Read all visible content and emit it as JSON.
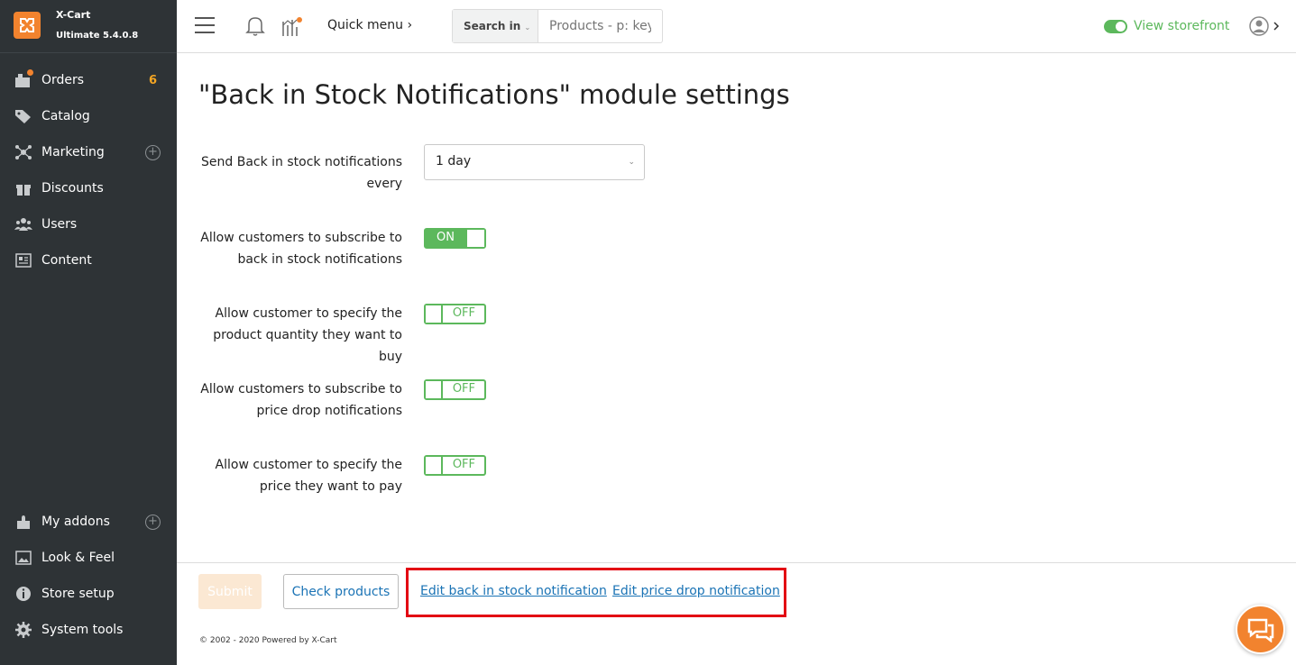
{
  "brand": {
    "name": "X-Cart",
    "version": "Ultimate 5.4.0.8"
  },
  "sidebar": {
    "items": [
      {
        "label": "Orders",
        "badge": "6",
        "icon": "orders-icon"
      },
      {
        "label": "Catalog",
        "icon": "tag-icon"
      },
      {
        "label": "Marketing",
        "icon": "network-icon"
      },
      {
        "label": "Discounts",
        "icon": "gift-icon"
      },
      {
        "label": "Users",
        "icon": "users-icon"
      },
      {
        "label": "Content",
        "icon": "newspaper-icon"
      }
    ],
    "bottom_items": [
      {
        "label": "My addons",
        "icon": "puzzle-icon"
      },
      {
        "label": "Look & Feel",
        "icon": "image-icon"
      },
      {
        "label": "Store setup",
        "icon": "info-icon"
      },
      {
        "label": "System tools",
        "icon": "gear-icon"
      }
    ]
  },
  "header": {
    "quick_menu": "Quick menu ›",
    "search_in": "Search in",
    "search_placeholder": "Products - p: key",
    "view_storefront": "View storefront"
  },
  "main": {
    "title": "\"Back in Stock Notifications\" module settings",
    "settings": [
      {
        "label": "Send Back in stock notifications every",
        "type": "select",
        "value": "1 day"
      },
      {
        "label": "Allow customers to subscribe to back in stock notifications",
        "type": "switch",
        "value": "ON"
      },
      {
        "label": "Allow customer to specify the product quantity they want to buy",
        "type": "switch",
        "value": "OFF"
      },
      {
        "label": "Allow customers to subscribe to price drop notifications",
        "type": "switch",
        "value": "OFF"
      },
      {
        "label": "Allow customer to specify the price they want to pay",
        "type": "switch",
        "value": "OFF"
      }
    ]
  },
  "footer": {
    "submit": "Submit",
    "check_products": "Check products",
    "edit_back_in_stock": "Edit back in stock notification",
    "edit_price_drop": "Edit price drop notification",
    "copyright": "© 2002 - 2020 Powered by X-Cart"
  },
  "colors": {
    "accent": "#f2832e",
    "sidebar_bg": "#2e3336",
    "green": "#5cb85c",
    "link": "#1a73b5",
    "highlight": "#e30613"
  }
}
